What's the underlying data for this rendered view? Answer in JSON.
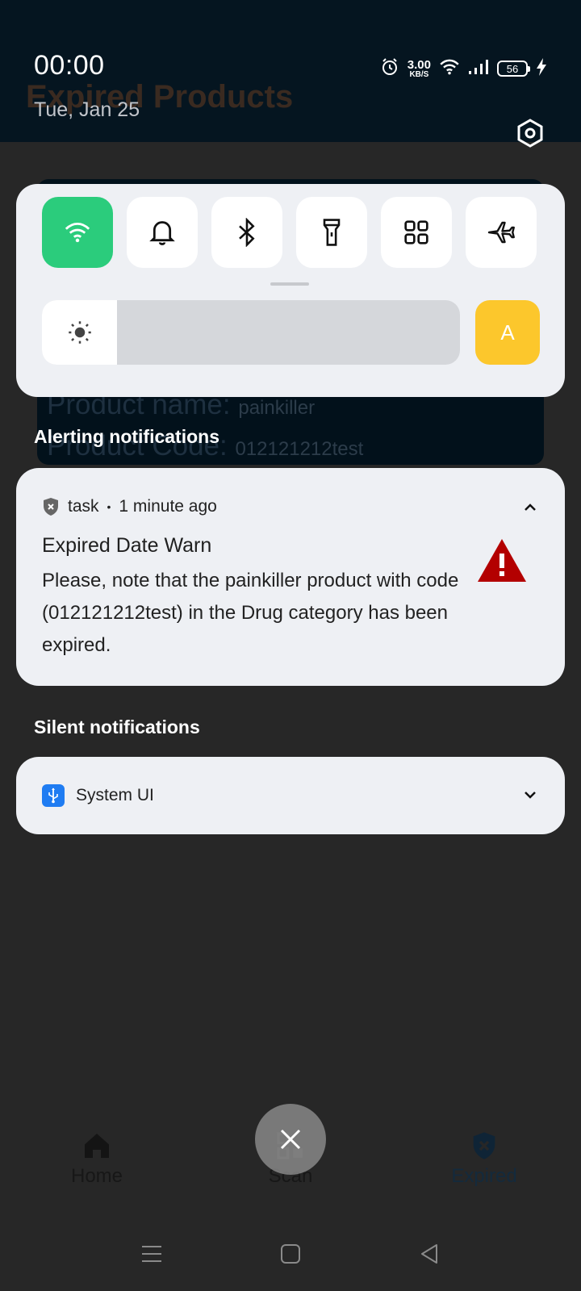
{
  "background_app": {
    "title": "Expired Products",
    "card": {
      "name_label": "Product name:",
      "name_value": "painkiller",
      "code_label": "Product Code:",
      "code_value": "012121212test"
    },
    "nav": [
      {
        "label": "Home",
        "icon": "home-icon"
      },
      {
        "label": "Scan",
        "icon": "qr-scan-icon"
      },
      {
        "label": "Expired",
        "icon": "shield-x-icon"
      }
    ]
  },
  "status_bar": {
    "time": "00:00",
    "date": "Tue, Jan 25",
    "net_speed": "3.00",
    "net_speed_unit": "KB/S",
    "battery": "56"
  },
  "quick_settings": {
    "tiles": [
      {
        "name": "wifi",
        "icon": "wifi-icon",
        "on": true
      },
      {
        "name": "notifications",
        "icon": "bell-icon",
        "on": false
      },
      {
        "name": "bluetooth",
        "icon": "bluetooth-icon",
        "on": false
      },
      {
        "name": "flashlight",
        "icon": "flashlight-icon",
        "on": false
      },
      {
        "name": "apps",
        "icon": "grid-icon",
        "on": false
      },
      {
        "name": "airplane",
        "icon": "airplane-icon",
        "on": false
      }
    ],
    "brightness_level": 0.18,
    "auto_brightness_label": "A",
    "accent_on": "#2bcc7c",
    "auto_color": "#fcc72c"
  },
  "sections": {
    "alerting": "Alerting notifications",
    "silent": "Silent notifications"
  },
  "alert_notification": {
    "app": "task",
    "separator": "•",
    "time": "1 minute ago",
    "title": "Expired Date Warn",
    "body": "Please, note that the painkiller product with code (012121212test) in the Drug category has been expired.",
    "icon": "warning-icon",
    "icon_color": "#b30000"
  },
  "silent_notification": {
    "app": "System UI",
    "icon": "usb-icon"
  }
}
